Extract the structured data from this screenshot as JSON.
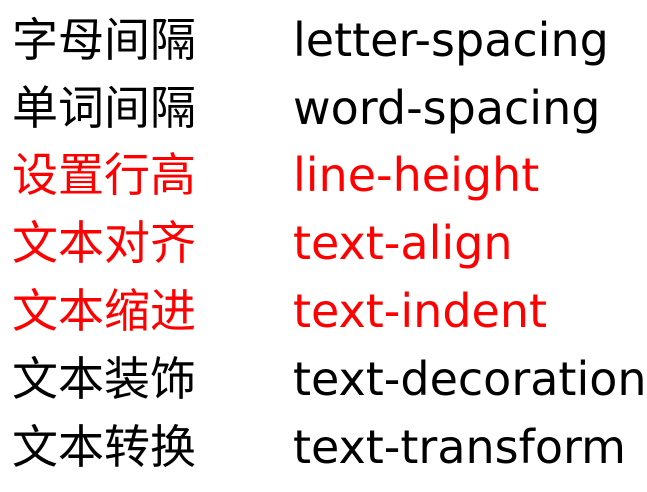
{
  "rows": [
    {
      "label": "字母间隔",
      "property": "letter-spacing",
      "color": "#000000"
    },
    {
      "label": "单词间隔",
      "property": "word-spacing",
      "color": "#000000"
    },
    {
      "label": "设置行高",
      "property": "line-height",
      "color": "#ff0000"
    },
    {
      "label": "文本对齐",
      "property": "text-align",
      "color": "#ff0000"
    },
    {
      "label": "文本缩进",
      "property": "text-indent",
      "color": "#ff0000"
    },
    {
      "label": "文本装饰",
      "property": "text-decoration",
      "color": "#000000"
    },
    {
      "label": "文本转换",
      "property": "text-transform",
      "color": "#000000"
    }
  ]
}
